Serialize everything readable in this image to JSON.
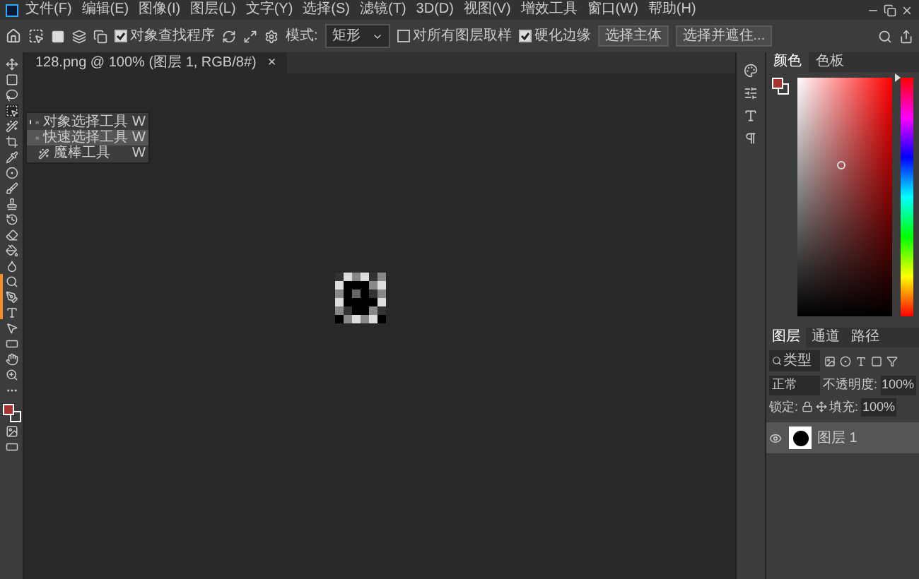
{
  "menu": [
    "文件(F)",
    "编辑(E)",
    "图像(I)",
    "图层(L)",
    "文字(Y)",
    "选择(S)",
    "滤镜(T)",
    "3D(D)",
    "视图(V)",
    "增效工具",
    "窗口(W)",
    "帮助(H)"
  ],
  "options": {
    "object_finder": {
      "label": "对象查找程序",
      "checked": true
    },
    "mode_label": "模式:",
    "mode_value": "矩形",
    "sample_all": {
      "label": "对所有图层取样",
      "checked": false
    },
    "hard_edge": {
      "label": "硬化边缘",
      "checked": true
    },
    "buttons": [
      "选择主体",
      "选择并遮住..."
    ]
  },
  "document_tab": {
    "title": "128.png @ 100% (图层 1, RGB/8#)",
    "close": "×"
  },
  "tool_flyout": [
    {
      "label": "对象选择工具",
      "shortcut": "W",
      "current": true,
      "selected": false
    },
    {
      "label": "快速选择工具",
      "shortcut": "W",
      "current": false,
      "selected": true
    },
    {
      "label": "魔棒工具",
      "shortcut": "W",
      "current": false,
      "selected": false
    }
  ],
  "hue_slider": {
    "level": 0
  },
  "color_tabs": [
    {
      "label": "颜色",
      "selected": true
    },
    {
      "label": "色板",
      "selected": false
    }
  ],
  "layers_panel": {
    "tabs": [
      {
        "label": "图层",
        "selected": true
      },
      {
        "label": "通道",
        "selected": false
      },
      {
        "label": "路径",
        "selected": false
      }
    ],
    "filter": "类型",
    "blend_mode": "正常",
    "opacity_label": "不透明度:",
    "opacity_value": "100%",
    "lock_label": "锁定:",
    "fill_label": "填充:",
    "fill_value": "100%",
    "layers": [
      {
        "name": "图层 1",
        "visible": true,
        "selected": true
      }
    ]
  }
}
